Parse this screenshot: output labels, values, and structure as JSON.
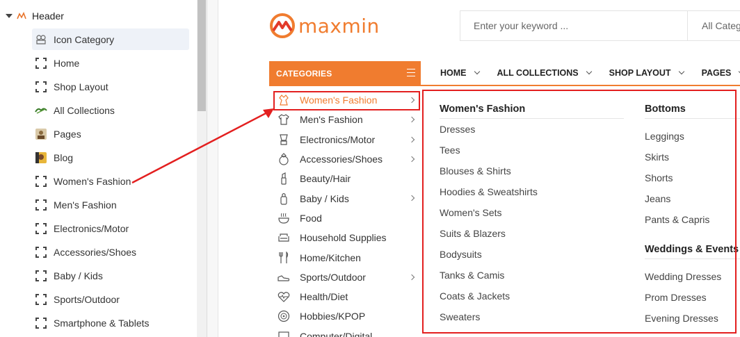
{
  "editor": {
    "section_title": "Header",
    "items": [
      {
        "label": "Icon Category",
        "icon": "puzzle-icon",
        "selected": true
      },
      {
        "label": "Home",
        "icon": "dashed-square-icon"
      },
      {
        "label": "Shop Layout",
        "icon": "dashed-square-icon"
      },
      {
        "label": "All Collections",
        "icon": "leaf-icon"
      },
      {
        "label": "Pages",
        "icon": "image-thumbnail-icon"
      },
      {
        "label": "Blog",
        "icon": "image-thumbnail-icon"
      },
      {
        "label": "Women's Fashion",
        "icon": "dashed-square-icon"
      },
      {
        "label": "Men's Fashion",
        "icon": "dashed-square-icon"
      },
      {
        "label": "Electronics/Motor",
        "icon": "dashed-square-icon"
      },
      {
        "label": "Accessories/Shoes",
        "icon": "dashed-square-icon"
      },
      {
        "label": "Baby / Kids",
        "icon": "dashed-square-icon"
      },
      {
        "label": "Sports/Outdoor",
        "icon": "dashed-square-icon"
      },
      {
        "label": "Smartphone & Tablets",
        "icon": "dashed-square-icon"
      }
    ]
  },
  "store": {
    "brand": "maxmin",
    "brand_color": "#f07c2f",
    "search": {
      "placeholder": "Enter your keyword ...",
      "category": "All Catego"
    },
    "categories_label": "CATEGORIES",
    "nav": [
      "HOME",
      "ALL COLLECTIONS",
      "SHOP LAYOUT",
      "PAGES"
    ],
    "category_list": [
      {
        "label": "Women's Fashion",
        "icon": "dress-icon",
        "has_sub": true,
        "active": true
      },
      {
        "label": "Men's Fashion",
        "icon": "shirt-icon",
        "has_sub": true
      },
      {
        "label": "Electronics/Motor",
        "icon": "blender-icon",
        "has_sub": true
      },
      {
        "label": "Accessories/Shoes",
        "icon": "ring-icon",
        "has_sub": true
      },
      {
        "label": "Beauty/Hair",
        "icon": "lipstick-icon",
        "has_sub": false
      },
      {
        "label": "Baby / Kids",
        "icon": "baby-bottle-icon",
        "has_sub": true
      },
      {
        "label": "Food",
        "icon": "food-bowl-icon",
        "has_sub": false
      },
      {
        "label": "Household Supplies",
        "icon": "sofa-icon",
        "has_sub": false
      },
      {
        "label": "Home/Kitchen",
        "icon": "cutlery-icon",
        "has_sub": false
      },
      {
        "label": "Sports/Outdoor",
        "icon": "sneaker-icon",
        "has_sub": true
      },
      {
        "label": "Health/Diet",
        "icon": "heartbeat-icon",
        "has_sub": false
      },
      {
        "label": "Hobbies/KPOP",
        "icon": "vinyl-icon",
        "has_sub": false
      },
      {
        "label": "Computer/Digital",
        "icon": "monitor-icon",
        "has_sub": false
      }
    ],
    "mega_menu": {
      "col1": {
        "title": "Women's Fashion",
        "links": [
          "Dresses",
          "Tees",
          "Blouses & Shirts",
          "Hoodies & Sweatshirts",
          "Women's Sets",
          "Suits & Blazers",
          "Bodysuits",
          "Tanks & Camis",
          "Coats & Jackets",
          "Sweaters"
        ]
      },
      "col2": {
        "title": "Bottoms",
        "links": [
          "Leggings",
          "Skirts",
          "Shorts",
          "Jeans",
          "Pants & Capris"
        ],
        "title2": "Weddings & Events",
        "links2": [
          "Wedding Dresses",
          "Prom Dresses",
          "Evening Dresses"
        ]
      }
    }
  },
  "annotation_color": "#e31f1f"
}
